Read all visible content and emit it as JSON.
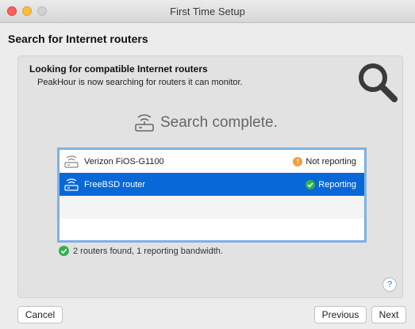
{
  "window": {
    "title": "First Time Setup"
  },
  "heading": "Search for Internet routers",
  "panel": {
    "title": "Looking for compatible Internet routers",
    "description": "PeakHour is now searching for routers it can monitor.",
    "status": "Search complete."
  },
  "routers": [
    {
      "name": "Verizon FiOS-G1100",
      "status": "Not reporting",
      "status_icon": "warning-icon",
      "status_color": "#f0a040",
      "selected": false
    },
    {
      "name": "FreeBSD router",
      "status": "Reporting",
      "status_icon": "checkmark-icon",
      "status_color": "#31b14a",
      "selected": true
    }
  ],
  "summary": "2 routers found, 1 reporting bandwidth.",
  "help": "?",
  "buttons": {
    "cancel": "Cancel",
    "previous": "Previous",
    "next": "Next"
  },
  "colors": {
    "selection": "#0868d7",
    "list_border": "#7db1e6",
    "success": "#31b14a",
    "warning": "#f0a040"
  }
}
